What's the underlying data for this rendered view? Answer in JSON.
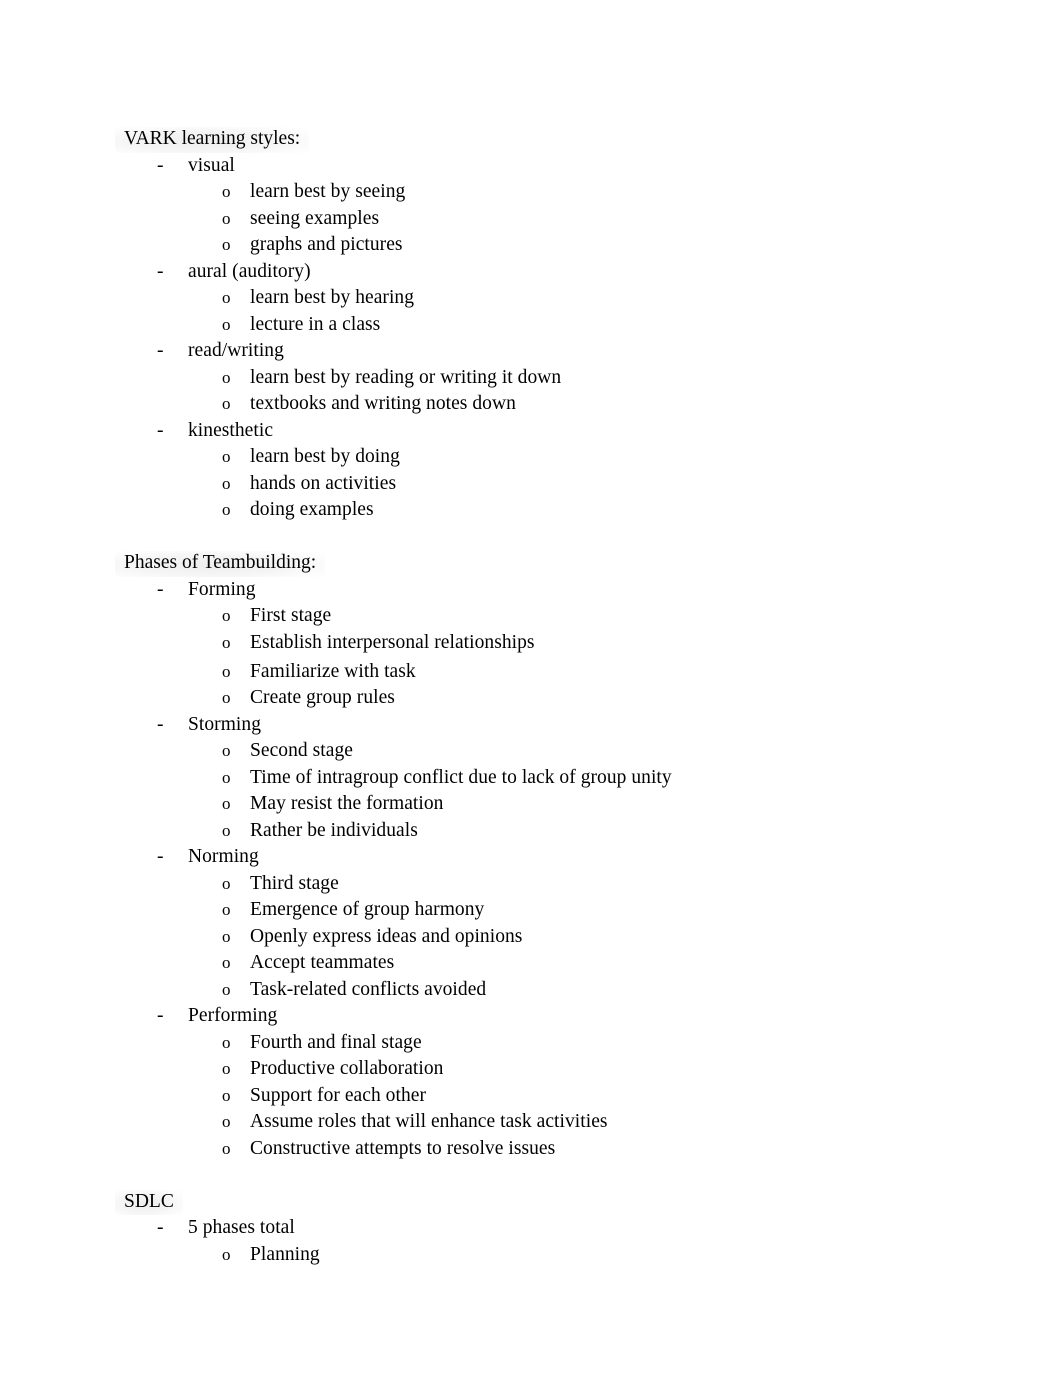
{
  "document": {
    "background_color": "#ffffff",
    "text_color": "#000000",
    "dash_marker": "-",
    "circle_marker": "o",
    "sections": [
      {
        "heading": "VARK learning styles:",
        "items": [
          {
            "label": "visual",
            "sub": [
              "learn best by seeing",
              "seeing examples",
              "graphs and pictures"
            ]
          },
          {
            "label": "aural (auditory)",
            "sub": [
              "learn best by hearing",
              "lecture in a class"
            ]
          },
          {
            "label": "read/writing",
            "sub": [
              "learn best by reading or writing it down",
              "textbooks and writing notes down"
            ]
          },
          {
            "label": "kinesthetic",
            "sub": [
              "learn best by doing",
              "hands on activities",
              "doing examples"
            ]
          }
        ]
      },
      {
        "heading": "Phases of Teambuilding:",
        "items": [
          {
            "label": "Forming",
            "sub": [
              "First stage",
              "Establish interpersonal relationships",
              "Familiarize with task",
              "Create group rules"
            ]
          },
          {
            "label": "Storming",
            "sub": [
              "Second stage",
              "Time of intragroup conflict due to lack of group unity",
              "May resist the formation",
              "Rather be individuals"
            ]
          },
          {
            "label": "Norming",
            "sub": [
              "Third stage",
              "Emergence of group harmony",
              "Openly express ideas and opinions",
              "Accept teammates",
              "Task-related conflicts avoided"
            ]
          },
          {
            "label": "Performing",
            "sub": [
              "Fourth and final stage",
              "Productive collaboration",
              "Support for each other",
              "Assume roles that will enhance task activities",
              "Constructive attempts to resolve issues"
            ]
          }
        ]
      },
      {
        "heading": "SDLC",
        "items": [
          {
            "label": "5 phases total",
            "sub": [
              "Planning"
            ]
          }
        ]
      }
    ]
  }
}
